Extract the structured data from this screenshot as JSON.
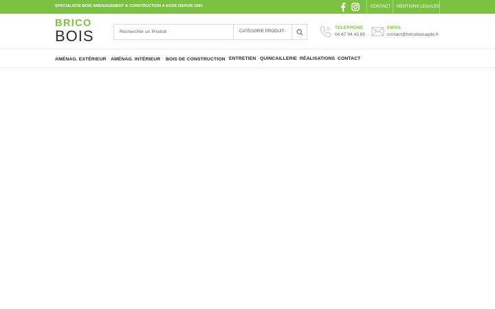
{
  "topbar": {
    "tagline": "SPECIALISTE BOIS AMENAGEMENT & CONSTRUCTION A AGDE DEPUIS 1981",
    "links": [
      "CONTACT",
      "MENTIONS LEGALES"
    ],
    "social": [
      "facebook-icon",
      "instagram-icon"
    ],
    "bg_color": "#7cc242"
  },
  "header": {
    "logo": {
      "line1": "BRICO",
      "line2": "BOIS"
    },
    "search": {
      "placeholder": "Rechercher un Produit",
      "category_label": "CATÉGORIE PRODUIT"
    },
    "phone": {
      "title": "TELEPHONE",
      "value": "04 67 94 43 65"
    },
    "email": {
      "title": "EMAIL",
      "value": "contact@bricoboisagde.fr"
    }
  },
  "nav": {
    "items": [
      {
        "label": "AMÉNAG. EXTÉRIEUR",
        "has_dropdown": true
      },
      {
        "label": "AMÉNAG. INTÉRIEUR",
        "has_dropdown": true
      },
      {
        "label": "BOIS DE CONSTRUCTION",
        "has_dropdown": true
      },
      {
        "label": "ENTRETIEN",
        "has_dropdown": false
      },
      {
        "label": "QUINCAILLERIE",
        "has_dropdown": false
      },
      {
        "label": "RÉALISATIONS",
        "has_dropdown": false
      },
      {
        "label": "CONTACT",
        "has_dropdown": false
      }
    ]
  },
  "colors": {
    "accent": "#7cc242",
    "text": "#222222"
  }
}
